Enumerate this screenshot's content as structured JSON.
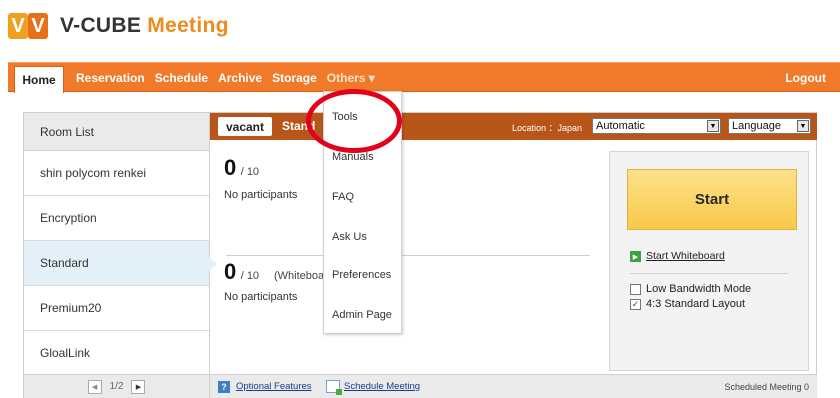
{
  "brand": {
    "mark_letters": [
      "V",
      "V"
    ],
    "name_part1": "V-CUBE",
    "name_part2": "Meeting",
    "colors": {
      "mark_light": "#f0a020",
      "mark_dark": "#e8701a",
      "accent": "#f08a1c"
    }
  },
  "nav": {
    "home": "Home",
    "items": [
      "Reservation",
      "Schedule",
      "Archive",
      "Storage"
    ],
    "others": "Others ▾",
    "logout": "Logout",
    "bar_color": "#f07a2a"
  },
  "sidebar": {
    "header": "Room List",
    "items": [
      {
        "label": "shin polycom renkei"
      },
      {
        "label": "Encryption"
      },
      {
        "label": "Standard"
      },
      {
        "label": "Premium20"
      },
      {
        "label": "GloalLink"
      }
    ],
    "active_index": 2,
    "pager": {
      "prev_icon": "◀",
      "text": "1/2",
      "next_icon": "▶"
    }
  },
  "room": {
    "status": "vacant",
    "name": "Stand",
    "location_label": "Location ：Japan",
    "timezone_select": "Automatic",
    "language_select": "Language",
    "bar_color": "#b8561a"
  },
  "meeting": {
    "count": "0",
    "max": "/ 10",
    "no_participants": "No participants"
  },
  "whiteboard_meeting": {
    "count": "0",
    "max": "/ 10",
    "label": "(Whiteboa",
    "no_participants": "No participants"
  },
  "start_panel": {
    "start": "Start",
    "whiteboard_link": "Start Whiteboard",
    "options": [
      {
        "label": "Low Bandwidth Mode",
        "checked": false
      },
      {
        "label": "4:3 Standard Layout",
        "checked": true
      }
    ]
  },
  "footer": {
    "help_icon": "?",
    "optional_features": "Optional Features",
    "schedule_meeting": "Schedule Meeting",
    "scheduled_count": "Scheduled Meeting 0"
  },
  "dropdown": {
    "items": [
      "Tools",
      "Manuals",
      "FAQ",
      "Ask Us",
      "Preferences",
      "Admin Page"
    ]
  },
  "annotation": {
    "color": "#e3001b"
  }
}
